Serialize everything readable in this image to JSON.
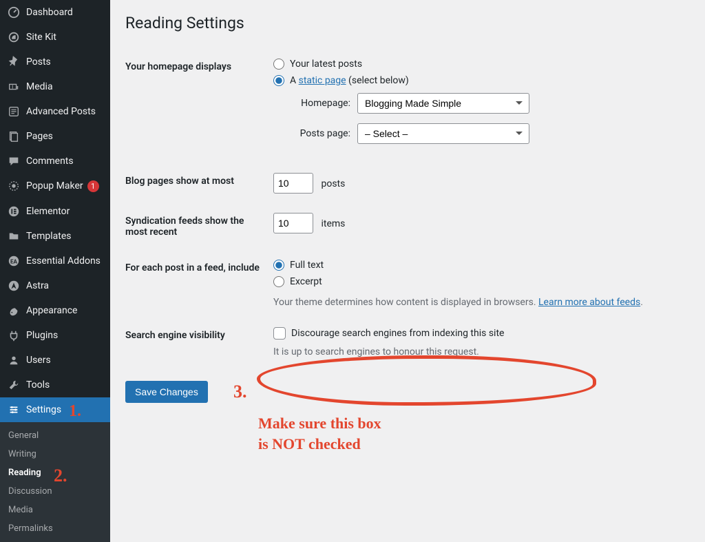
{
  "sidebar": {
    "items": [
      {
        "label": "Dashboard",
        "icon": "dashboard"
      },
      {
        "label": "Site Kit",
        "icon": "sitekit"
      },
      {
        "label": "Posts",
        "icon": "pin"
      },
      {
        "label": "Media",
        "icon": "media"
      },
      {
        "label": "Advanced Posts",
        "icon": "advposts"
      },
      {
        "label": "Pages",
        "icon": "pages"
      },
      {
        "label": "Comments",
        "icon": "comments"
      },
      {
        "label": "Popup Maker",
        "icon": "popup",
        "badge": "1"
      },
      {
        "label": "Elementor",
        "icon": "elementor"
      },
      {
        "label": "Templates",
        "icon": "templates"
      },
      {
        "label": "Essential Addons",
        "icon": "ea"
      },
      {
        "label": "Astra",
        "icon": "astra"
      },
      {
        "label": "Appearance",
        "icon": "appearance"
      },
      {
        "label": "Plugins",
        "icon": "plugins"
      },
      {
        "label": "Users",
        "icon": "users"
      },
      {
        "label": "Tools",
        "icon": "tools"
      },
      {
        "label": "Settings",
        "icon": "settings",
        "active": true
      }
    ],
    "submenu": [
      "General",
      "Writing",
      "Reading",
      "Discussion",
      "Media",
      "Permalinks"
    ],
    "submenu_current": "Reading"
  },
  "page": {
    "title": "Reading Settings",
    "homepage_displays_label": "Your homepage displays",
    "radio_latest": "Your latest posts",
    "radio_static_prefix": "A ",
    "radio_static_link": "static page",
    "radio_static_suffix": " (select below)",
    "homepage_label": "Homepage:",
    "homepage_select": "Blogging Made Simple",
    "posts_page_label": "Posts page:",
    "posts_page_select": "– Select –",
    "blog_pages_label": "Blog pages show at most",
    "blog_pages_value": "10",
    "blog_pages_unit": "posts",
    "syndication_label": "Syndication feeds show the most recent",
    "syndication_value": "10",
    "syndication_unit": "items",
    "feed_include_label": "For each post in a feed, include",
    "feed_full": "Full text",
    "feed_excerpt": "Excerpt",
    "feed_desc_prefix": "Your theme determines how content is displayed in browsers. ",
    "feed_desc_link": "Learn more about feeds",
    "visibility_label": "Search engine visibility",
    "visibility_checkbox": "Discourage search engines from indexing this site",
    "visibility_help": "It is up to search engines to honour this request.",
    "save": "Save Changes"
  },
  "annotations": {
    "n1": "1.",
    "n2": "2.",
    "n3": "3.",
    "note_line1": "Make sure this box",
    "note_line2": "is NOT checked"
  }
}
